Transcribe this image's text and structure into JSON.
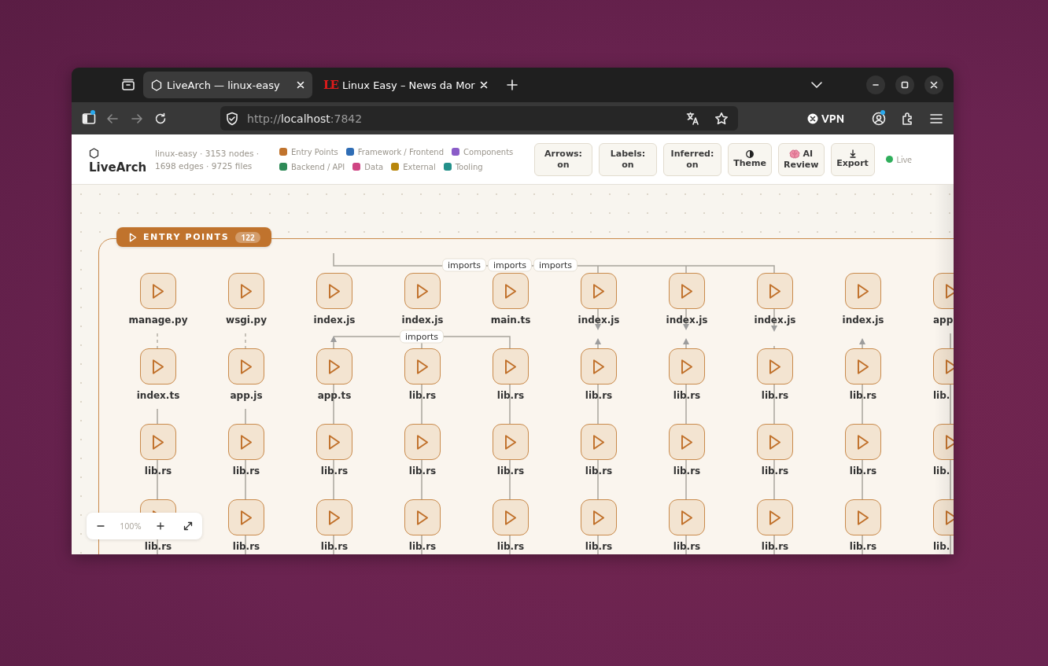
{
  "browser": {
    "tabs": [
      {
        "title": "LiveArch — linux-easy",
        "selected": true
      },
      {
        "title": "Linux Easy – News da Mor",
        "logo_text": "LE",
        "selected": false
      }
    ],
    "left_buttons": [
      {
        "kind": "sidebar",
        "notification": true,
        "disabled": false
      },
      {
        "kind": "back",
        "notification": false,
        "disabled": true
      },
      {
        "kind": "forward",
        "notification": false,
        "disabled": true
      },
      {
        "kind": "reload",
        "notification": false,
        "disabled": false
      }
    ],
    "address": {
      "prefix": "http://",
      "host": "localhost",
      "suffix": ":7842"
    },
    "vpn": {
      "label": "VPN"
    },
    "right_buttons": [
      {
        "kind": "account",
        "notification": true
      },
      {
        "kind": "extensions",
        "notification": false
      },
      {
        "kind": "menu",
        "notification": false
      }
    ]
  },
  "app": {
    "title": "LiveArch",
    "stats": "linux-easy · 3153 nodes · 1698 edges · 9725 files",
    "legend": [
      {
        "label": "Entry Points",
        "color": "#c0732d"
      },
      {
        "label": "Framework / Frontend",
        "color": "#2f6db5"
      },
      {
        "label": "Components",
        "color": "#8a5cc8"
      },
      {
        "label": "Backend / API",
        "color": "#2e8a57"
      },
      {
        "label": "Data",
        "color": "#cf4583"
      },
      {
        "label": "External",
        "color": "#b8860b"
      },
      {
        "label": "Tooling",
        "color": "#23908a"
      }
    ],
    "buttons": [
      {
        "label": "Arrows: on"
      },
      {
        "label": "Labels: on"
      },
      {
        "label": "Inferred: on"
      },
      {
        "label": "Theme"
      },
      {
        "label": "AI Review"
      },
      {
        "label": "Export"
      }
    ],
    "status": {
      "label": "Live",
      "connected": true
    }
  },
  "group": {
    "title": "ENTRY POINTS",
    "count": "122",
    "rows": [
      [
        "manage.py",
        "wsgi.py",
        "index.js",
        "index.js",
        "main.ts",
        "index.js",
        "index.js",
        "index.js",
        "index.js",
        "app"
      ],
      [
        "index.ts",
        "app.js",
        "app.ts",
        "lib.rs",
        "lib.rs",
        "lib.rs",
        "lib.rs",
        "lib.rs",
        "lib.rs",
        "lib."
      ],
      [
        "lib.rs",
        "lib.rs",
        "lib.rs",
        "lib.rs",
        "lib.rs",
        "lib.rs",
        "lib.rs",
        "lib.rs",
        "lib.rs",
        "lib."
      ],
      [
        "lib.rs",
        "lib.rs",
        "lib.rs",
        "lib.rs",
        "lib.rs",
        "lib.rs",
        "lib.rs",
        "lib.rs",
        "lib.rs",
        "lib."
      ]
    ]
  },
  "edge_labels": [
    "imports",
    "imports",
    "imports",
    "imports"
  ],
  "zoom": {
    "value": "100%"
  }
}
